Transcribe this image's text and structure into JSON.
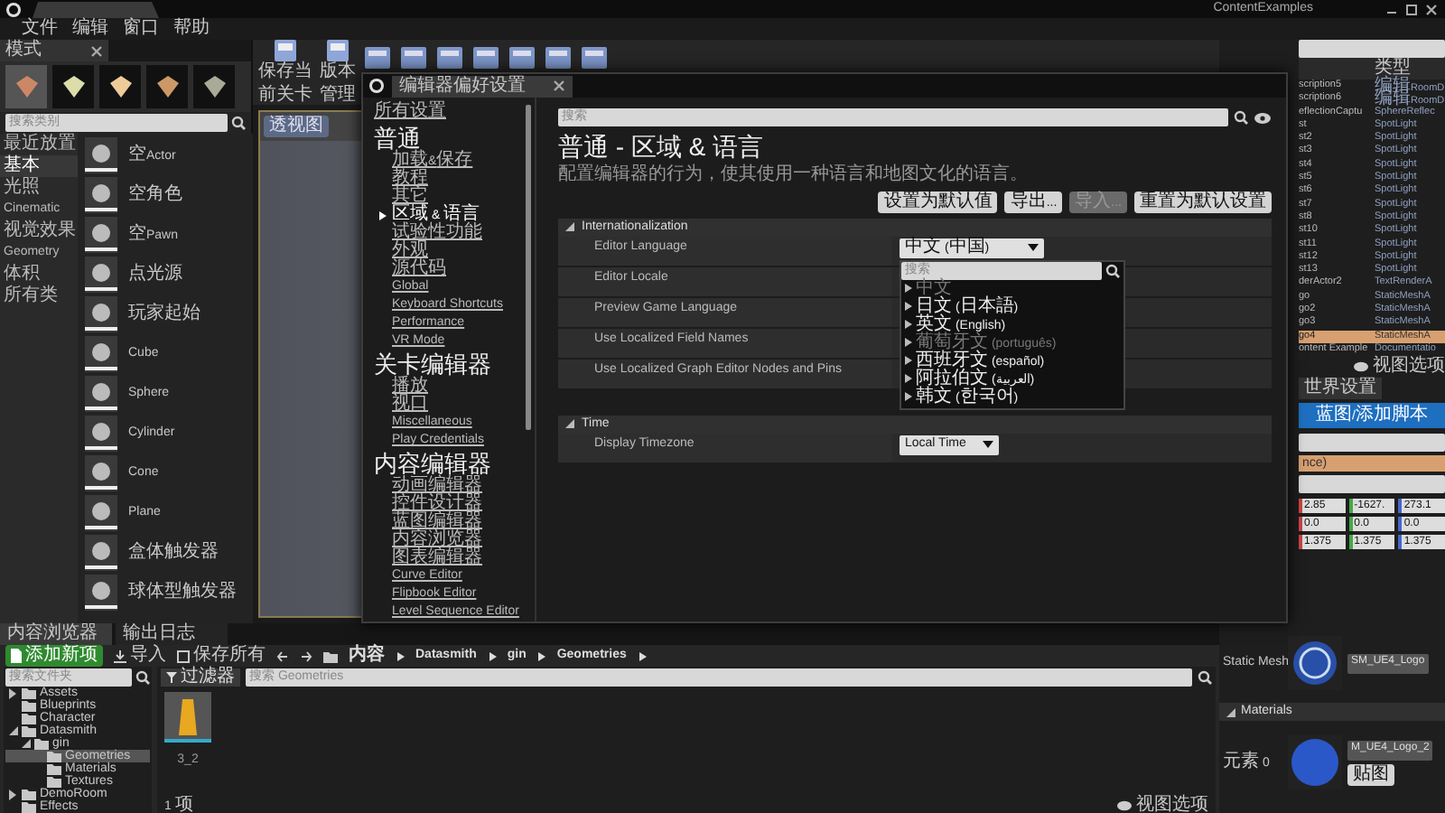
{
  "title_bar": {
    "app_title": "ContentExamples"
  },
  "menu": [
    {
      "label": "文件"
    },
    {
      "label": "编辑"
    },
    {
      "label": "窗口"
    },
    {
      "label": "帮助"
    }
  ],
  "modes_panel": {
    "title": "模式",
    "mode_tabs": [
      {
        "selected": true
      },
      {
        "selected": false
      },
      {
        "selected": false
      },
      {
        "selected": false
      },
      {
        "selected": false
      }
    ],
    "search": {
      "placeholder": "搜索类别"
    },
    "categories": [
      {
        "label": "最近放置",
        "selected": false
      },
      {
        "label": "基本",
        "selected": true
      },
      {
        "label": "光照",
        "selected": false
      },
      {
        "label": "Cinematic",
        "selected": false
      },
      {
        "label": "视觉效果",
        "selected": false
      },
      {
        "label": "Geometry",
        "selected": false
      },
      {
        "label": "体积",
        "selected": false
      },
      {
        "label": "所有类",
        "selected": false
      }
    ],
    "items": [
      {
        "label": "空Actor"
      },
      {
        "label": "空角色"
      },
      {
        "label": "空Pawn"
      },
      {
        "label": "点光源"
      },
      {
        "label": "玩家起始"
      },
      {
        "label": "Cube"
      },
      {
        "label": "Sphere"
      },
      {
        "label": "Cylinder"
      },
      {
        "label": "Cone"
      },
      {
        "label": "Plane"
      },
      {
        "label": "盒体触发器"
      },
      {
        "label": "球体型触发器"
      }
    ]
  },
  "toolbar": {
    "buttons": [
      {
        "label": "保存当前关卡"
      },
      {
        "label": "版本管理"
      }
    ]
  },
  "viewport": {
    "view_button": "透视图"
  },
  "preferences_dialog": {
    "title": "编辑器偏好设置",
    "all_settings": "所有设置",
    "nav_groups": [
      {
        "heading": "普通",
        "items": [
          {
            "label": "加载&保存",
            "selected": false
          },
          {
            "label": "教程",
            "selected": false
          },
          {
            "label": "其它",
            "selected": false
          },
          {
            "label": "区域 & 语言",
            "selected": true
          },
          {
            "label": "试验性功能",
            "selected": false
          },
          {
            "label": "外观",
            "selected": false
          },
          {
            "label": "源代码",
            "selected": false
          },
          {
            "label": "Global",
            "selected": false
          },
          {
            "label": "Keyboard Shortcuts",
            "selected": false
          },
          {
            "label": "Performance",
            "selected": false
          },
          {
            "label": "VR Mode",
            "selected": false
          }
        ]
      },
      {
        "heading": "关卡编辑器",
        "items": [
          {
            "label": "播放",
            "selected": false
          },
          {
            "label": "视口",
            "selected": false
          },
          {
            "label": "Miscellaneous",
            "selected": false
          },
          {
            "label": "Play Credentials",
            "selected": false
          }
        ]
      },
      {
        "heading": "内容编辑器",
        "items": [
          {
            "label": "动画编辑器",
            "selected": false
          },
          {
            "label": "控件设计器",
            "selected": false
          },
          {
            "label": "蓝图编辑器",
            "selected": false
          },
          {
            "label": "内容浏览器",
            "selected": false
          },
          {
            "label": "图表编辑器",
            "selected": false
          },
          {
            "label": "Curve Editor",
            "selected": false
          },
          {
            "label": "Flipbook Editor",
            "selected": false
          },
          {
            "label": "Level Sequence Editor",
            "selected": false
          }
        ]
      }
    ],
    "search": {
      "placeholder": "搜索"
    },
    "heading": "普通 - 区域 & 语言",
    "description": "配置编辑器的行为，使其使用一种语言和地图文化的语言。",
    "buttons": [
      {
        "label": "设置为默认值",
        "disabled": false
      },
      {
        "label": "导出...",
        "disabled": false
      },
      {
        "label": "导入...",
        "disabled": true
      },
      {
        "label": "重置为默认设置",
        "disabled": false
      }
    ],
    "sections": [
      {
        "title": "Internationalization",
        "expanded": true,
        "rows": [
          {
            "label": "Editor Language",
            "kind": "dropdown",
            "value": "中文 (中国)"
          },
          {
            "label": "Editor Locale",
            "kind": "plain"
          },
          {
            "label": "Preview Game Language",
            "kind": "plain"
          },
          {
            "label": "Use Localized Field Names",
            "kind": "plain"
          },
          {
            "label": "Use Localized Graph Editor Nodes and Pins",
            "kind": "plain"
          }
        ]
      },
      {
        "title": "Time",
        "expanded": true,
        "rows": [
          {
            "label": "Display Timezone",
            "kind": "dropdown",
            "value": "Local Time"
          }
        ]
      }
    ],
    "language_menu": {
      "search": {
        "placeholder": "搜索"
      },
      "items": [
        {
          "label": "中文",
          "disabled": true
        },
        {
          "label": "日文 (日本語)",
          "disabled": false
        },
        {
          "label": "英文 (English)",
          "disabled": false
        },
        {
          "label": "葡萄牙文 (português)",
          "disabled": true
        },
        {
          "label": "西班牙文 (español)",
          "disabled": false
        },
        {
          "label": "阿拉伯文 (العربية)",
          "disabled": false
        },
        {
          "label": "韩文 (한국어)",
          "disabled": false
        }
      ]
    }
  },
  "outliner": {
    "header": "类型",
    "rows": [
      {
        "name": "scription5",
        "type": "编辑RoomD",
        "selected": false
      },
      {
        "name": "scription6",
        "type": "编辑RoomD",
        "selected": false
      },
      {
        "name": "eflectionCaptu",
        "type": "SphereReflec",
        "selected": false
      },
      {
        "name": "st",
        "type": "SpotLight",
        "selected": false
      },
      {
        "name": "st2",
        "type": "SpotLight",
        "selected": false
      },
      {
        "name": "st3",
        "type": "SpotLight",
        "selected": false
      },
      {
        "name": "st4",
        "type": "SpotLight",
        "selected": false
      },
      {
        "name": "st5",
        "type": "SpotLight",
        "selected": false
      },
      {
        "name": "st6",
        "type": "SpotLight",
        "selected": false
      },
      {
        "name": "st7",
        "type": "SpotLight",
        "selected": false
      },
      {
        "name": "st8",
        "type": "SpotLight",
        "selected": false
      },
      {
        "name": "st10",
        "type": "SpotLight",
        "selected": false
      },
      {
        "name": "st11",
        "type": "SpotLight",
        "selected": false
      },
      {
        "name": "st12",
        "type": "SpotLight",
        "selected": false
      },
      {
        "name": "st13",
        "type": "SpotLight",
        "selected": false
      },
      {
        "name": "derActor2",
        "type": "TextRenderA",
        "selected": false
      },
      {
        "name": "go",
        "type": "StaticMeshA",
        "selected": false
      },
      {
        "name": "go2",
        "type": "StaticMeshA",
        "selected": false
      },
      {
        "name": "go3",
        "type": "StaticMeshA",
        "selected": false
      },
      {
        "name": "go4",
        "type": "StaticMeshA",
        "selected": true
      },
      {
        "name": "ontent Example",
        "type": "Documentatio",
        "selected": false
      }
    ],
    "view_options": "视图选项"
  },
  "details": {
    "tab": "世界设置",
    "add_button": "蓝图/添加脚本",
    "component": "nce)",
    "transform": [
      [
        "2.85",
        "-1627.",
        "273.1"
      ],
      [
        "0.0",
        "0.0",
        "0.0"
      ],
      [
        "1.375",
        "1.375",
        "1.375"
      ]
    ],
    "static_mesh": {
      "label": "Static Mesh",
      "value": "SM_UE4_Logo"
    },
    "materials": {
      "title": "Materials",
      "label": "元素 0",
      "value": "M_UE4_Logo_2",
      "button": "贴图"
    }
  },
  "content_browser": {
    "tabs": [
      {
        "label": "内容浏览器",
        "selected": true
      },
      {
        "label": "输出日志",
        "selected": false
      }
    ],
    "add_button": "添加新项",
    "import_button": "导入",
    "save_button": "保存所有",
    "path": [
      "内容",
      "Datasmith",
      "gin",
      "Geometries"
    ],
    "folder_search": {
      "placeholder": "搜索文件夹"
    },
    "folders": [
      {
        "label": "Assets",
        "expanded": false,
        "selected": false
      },
      {
        "label": "Blueprints",
        "selected": false
      },
      {
        "label": "Character",
        "selected": false
      },
      {
        "label": "Datasmith",
        "expanded": true,
        "selected": false,
        "children": [
          {
            "label": "gin",
            "expanded": true,
            "selected": false,
            "children": [
              {
                "label": "Geometries",
                "selected": true
              },
              {
                "label": "Materials",
                "selected": false
              },
              {
                "label": "Textures",
                "selected": false
              }
            ]
          }
        ]
      },
      {
        "label": "DemoRoom",
        "expanded": false,
        "selected": false
      },
      {
        "label": "Effects",
        "selected": false
      }
    ],
    "filter_button": "过滤器",
    "asset_search": {
      "placeholder": "搜索 Geometries"
    },
    "assets": [
      {
        "name": "3_2"
      }
    ],
    "count": "1 项",
    "view_options": "视图选项"
  }
}
